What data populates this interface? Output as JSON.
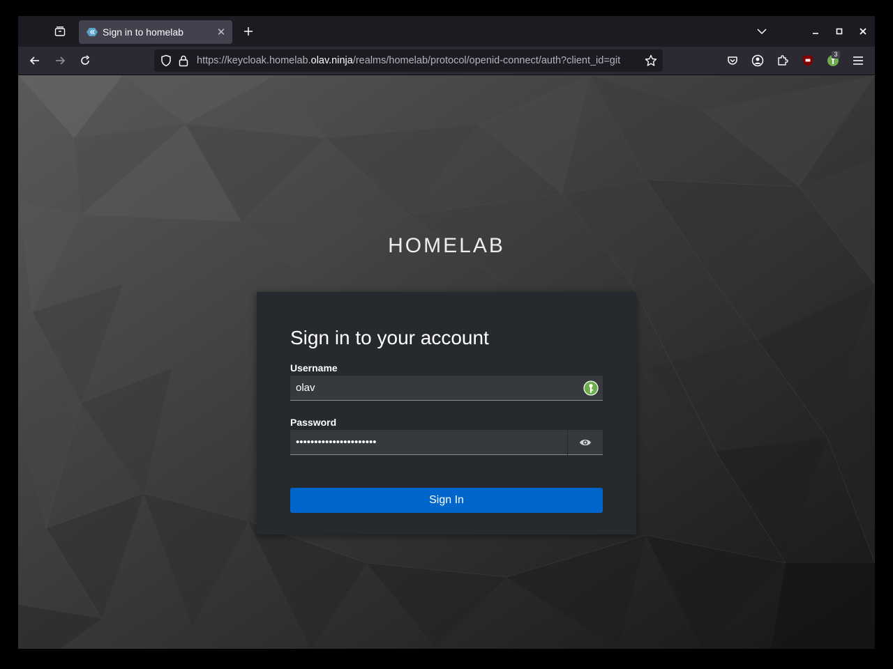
{
  "browser": {
    "tab": {
      "title": "Sign in to homelab",
      "close_glyph": "✕"
    },
    "new_tab_glyph": "+",
    "url": {
      "prefix": "https://keycloak.homelab.",
      "domain": "olav.ninja",
      "path": "/realms/homelab/protocol/openid-connect/auth?client_id=git"
    },
    "extensions": {
      "keepass_badge": "3"
    },
    "icons": [
      "firefox-view-icon",
      "chevron-down-icon",
      "minimize-icon",
      "maximize-icon",
      "close-icon",
      "back-arrow-icon",
      "forward-arrow-icon",
      "reload-icon",
      "shield-icon",
      "lock-icon",
      "star-icon",
      "pocket-icon",
      "account-icon",
      "extensions-icon",
      "ublock-icon",
      "keepassxc-icon",
      "hamburger-menu-icon"
    ]
  },
  "page": {
    "realm_title": "HOMELAB",
    "heading": "Sign in to your account",
    "username_label": "Username",
    "username_value": "olav",
    "password_label": "Password",
    "password_value": "supersecretpassword123",
    "signin_label": "Sign In"
  },
  "colors": {
    "accent": "#0066cc",
    "card_bg": "#26292d",
    "input_bg": "#36393e",
    "browser_bg": "#1c1b22",
    "toolbar_bg": "#2b2a33"
  }
}
